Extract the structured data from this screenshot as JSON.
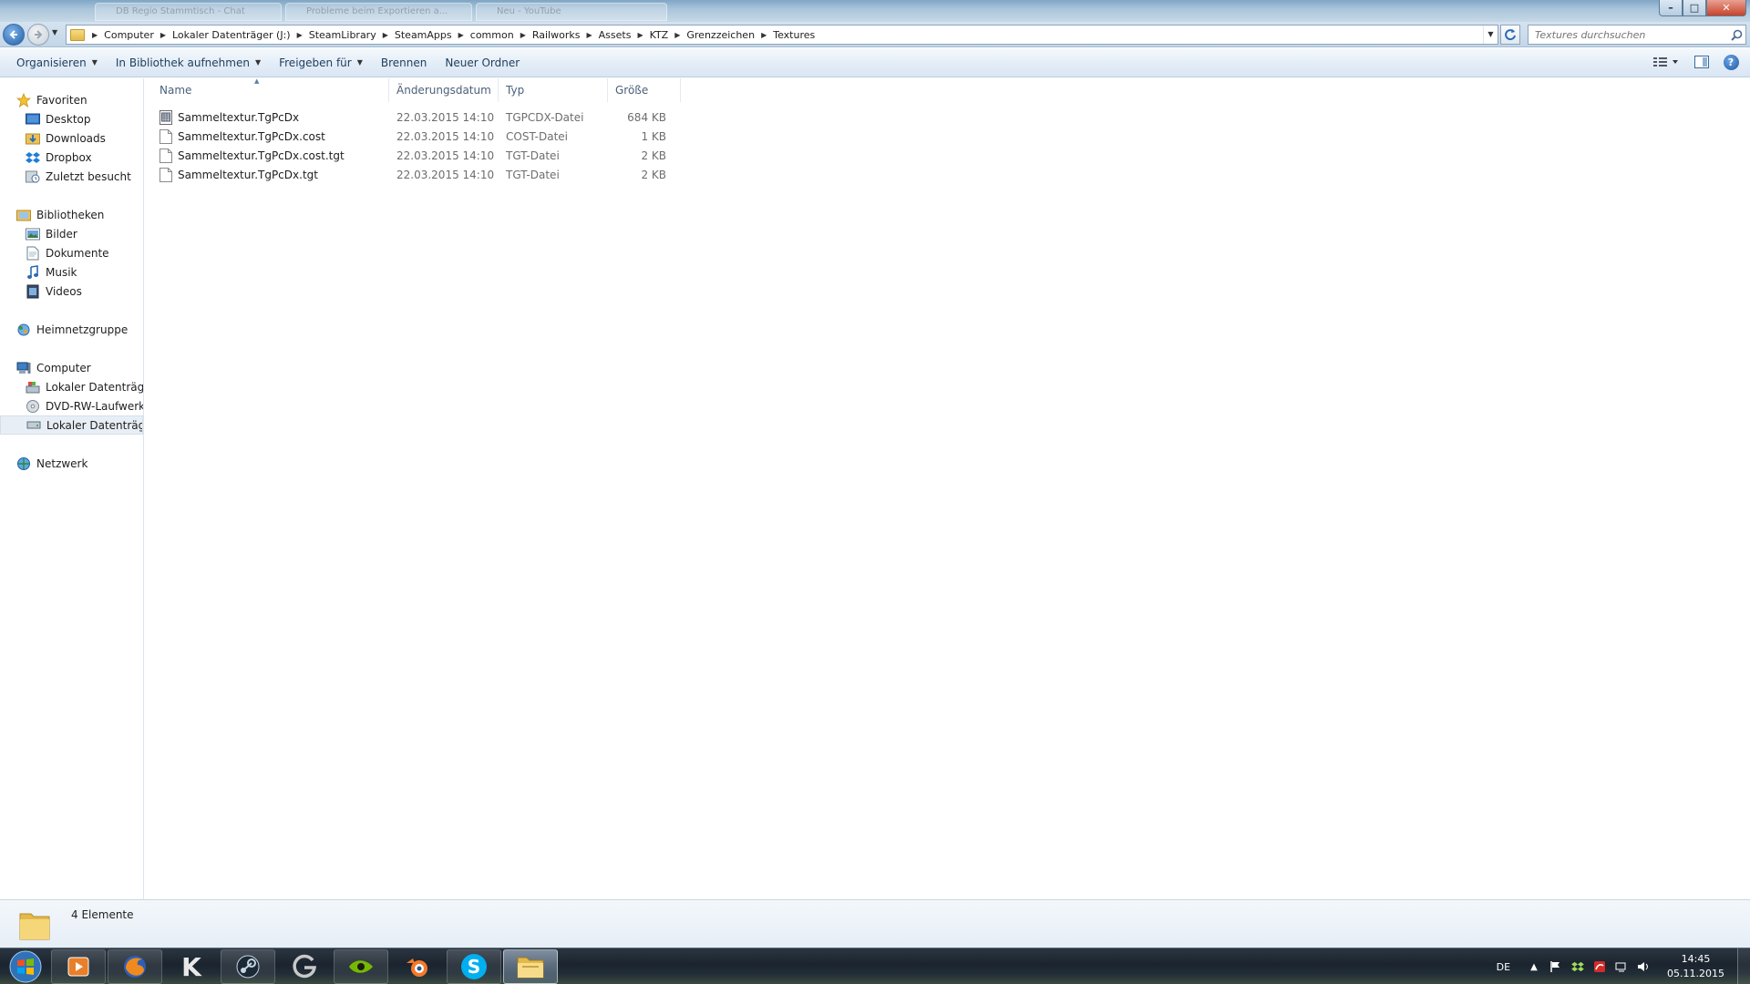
{
  "window": {
    "background_tabs": [
      "DB Regio Stammtisch - Chat",
      "Probleme beim Exportieren a...",
      "Neu - YouTube"
    ],
    "controls": {
      "minimize": "–",
      "maximize": "□",
      "close": "✕"
    }
  },
  "address": {
    "crumbs": [
      "Computer",
      "Lokaler Datenträger (J:)",
      "SteamLibrary",
      "SteamApps",
      "common",
      "Railworks",
      "Assets",
      "KTZ",
      "Grenzzeichen",
      "Textures"
    ]
  },
  "search": {
    "placeholder": "Textures durchsuchen"
  },
  "commands": {
    "organize": "Organisieren",
    "library": "In Bibliothek aufnehmen",
    "share": "Freigeben für",
    "burn": "Brennen",
    "new_folder": "Neuer Ordner"
  },
  "nav": {
    "favorites": "Favoriten",
    "desktop": "Desktop",
    "downloads": "Downloads",
    "dropbox": "Dropbox",
    "recent": "Zuletzt besucht",
    "libraries": "Bibliotheken",
    "pictures": "Bilder",
    "documents": "Dokumente",
    "music": "Musik",
    "videos": "Videos",
    "homegroup": "Heimnetzgruppe",
    "computer": "Computer",
    "drive_c": "Lokaler Datenträger",
    "dvd": "DVD-RW-Laufwerk (",
    "drive_j": "Lokaler Datenträger",
    "network": "Netzwerk"
  },
  "columns": {
    "name": "Name",
    "date": "Änderungsdatum",
    "type": "Typ",
    "size": "Größe"
  },
  "files": [
    {
      "name": "Sammeltextur.TgPcDx",
      "date": "22.03.2015 14:10",
      "type": "TGPCDX-Datei",
      "size": "684 KB",
      "icon": "texture-file-icon"
    },
    {
      "name": "Sammeltextur.TgPcDx.cost",
      "date": "22.03.2015 14:10",
      "type": "COST-Datei",
      "size": "1 KB",
      "icon": "generic-file-icon"
    },
    {
      "name": "Sammeltextur.TgPcDx.cost.tgt",
      "date": "22.03.2015 14:10",
      "type": "TGT-Datei",
      "size": "2 KB",
      "icon": "generic-file-icon"
    },
    {
      "name": "Sammeltextur.TgPcDx.tgt",
      "date": "22.03.2015 14:10",
      "type": "TGT-Datei",
      "size": "2 KB",
      "icon": "generic-file-icon"
    }
  ],
  "details": {
    "count": "4 Elemente"
  },
  "taskbar": {
    "k_label": "K",
    "s_label": "S",
    "language": "DE",
    "time": "14:45",
    "date": "05.11.2015"
  },
  "colors": {
    "accent": "#1f5fa8",
    "selection": "#e8eef5",
    "header_text": "#4c607a"
  }
}
